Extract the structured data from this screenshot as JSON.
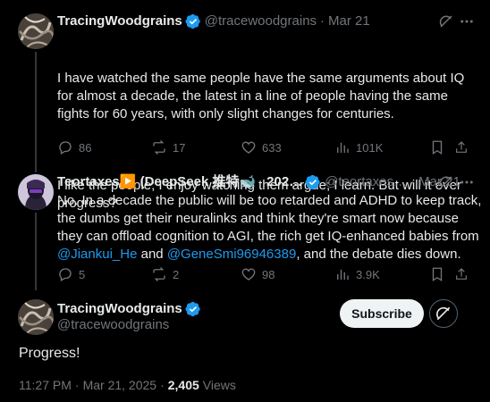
{
  "tweet1": {
    "display_name": "TracingWoodgrains",
    "handle": "@tracewoodgrains",
    "separator": "·",
    "date": "Mar 21",
    "text_p1": "I have watched the same people have the same arguments about IQ for almost a decade, the latest in a line of people having the same fights for 60 years, with only slight changes for centuries.",
    "text_p2": "I like the people; I enjoy watching them argue; I learn. But will it ever progress?",
    "replies": "86",
    "reposts": "17",
    "likes": "633",
    "views": "101K"
  },
  "tweet2": {
    "display_name": "Teortaxes▶️ (DeepSeek 推特🐋",
    "name_tail": "202…",
    "handle": "@teortaxes…",
    "separator": "·",
    "date": "Mar 21",
    "text_a": "No. In a decade the public will be too retarded and ADHD to keep track, the dumbs get their neuralinks and think they're smart now because they can offload cognition to AGI, the rich get IQ-enhanced babies from ",
    "mention1": "@Jiankui_He",
    "text_b": " and ",
    "mention2": "@GeneSmi96946389",
    "text_c": ", and the debate dies down.",
    "replies": "5",
    "reposts": "2",
    "likes": "98",
    "views": "3.9K"
  },
  "main": {
    "display_name": "TracingWoodgrains",
    "handle": "@tracewoodgrains",
    "subscribe_label": "Subscribe",
    "text": "Progress!",
    "time": "11:27 PM",
    "separator": "·",
    "date": "Mar 21, 2025",
    "views_count": "2,405",
    "views_label": "Views"
  },
  "colors": {
    "accent": "#1d9bf0",
    "muted": "#71767b",
    "text": "#e7e9ea",
    "background": "#000000"
  },
  "icons": [
    "grok-icon",
    "more-icon",
    "reply-icon",
    "repost-icon",
    "like-icon",
    "views-icon",
    "bookmark-icon",
    "share-icon",
    "verified-badge-icon"
  ]
}
